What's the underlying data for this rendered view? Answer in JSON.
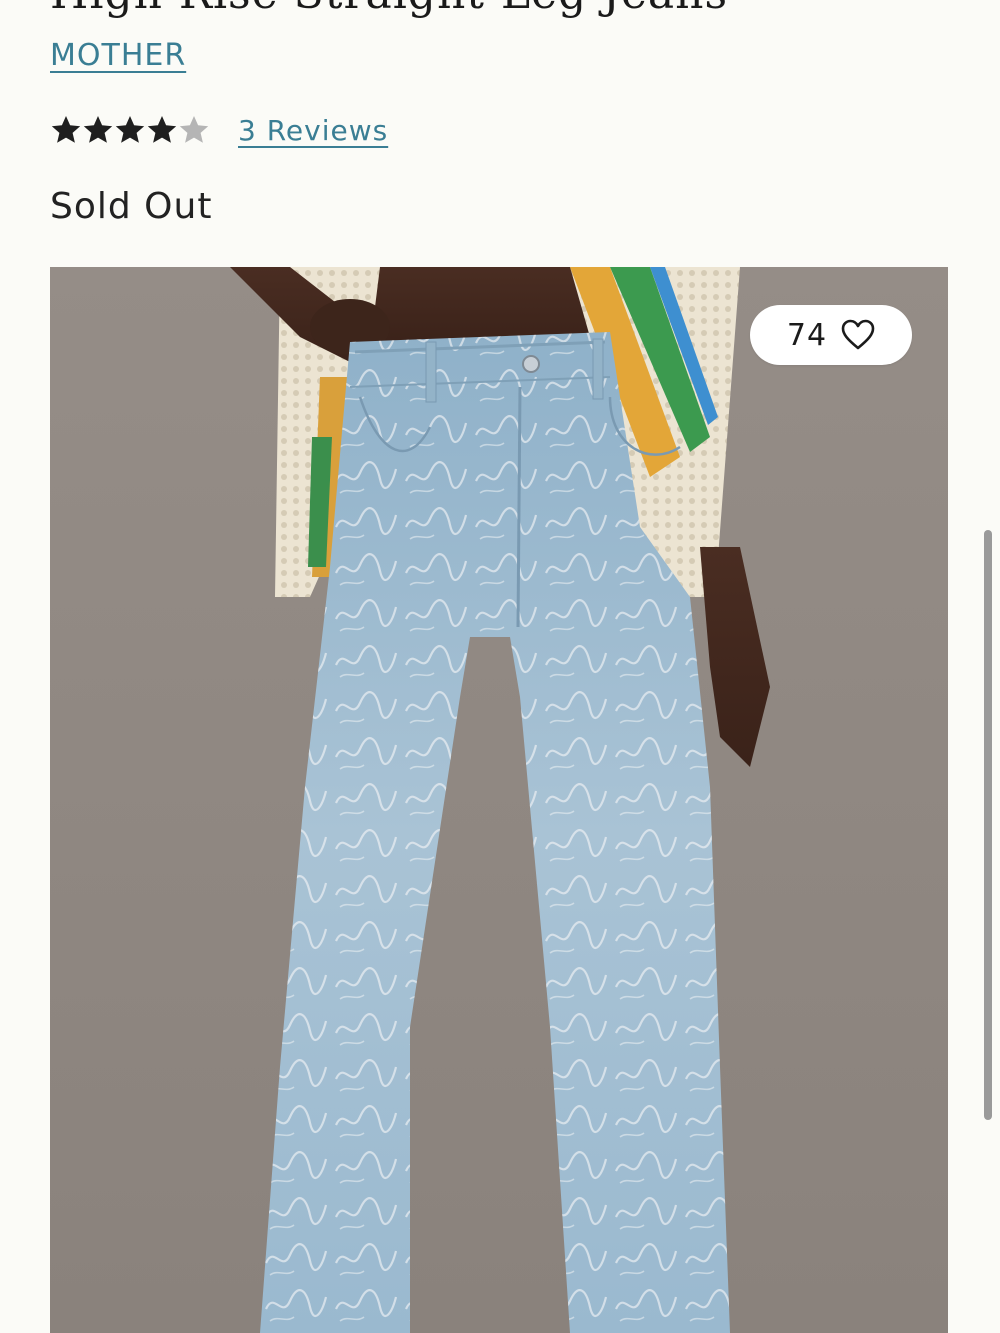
{
  "product": {
    "title": "High-Rise Straight-Leg Jeans",
    "brand": "MOTHER",
    "rating": 4,
    "rating_max": 5,
    "reviews_label": "3 Reviews",
    "availability": "Sold Out"
  },
  "favorite": {
    "count": "74",
    "icon": "heart-outline-icon"
  },
  "colors": {
    "link": "#3a7e94",
    "star_filled": "#1f1f1f",
    "star_empty": "#b5b5b5",
    "background": "#fbfbf7",
    "image_backdrop": "#8e8680"
  }
}
